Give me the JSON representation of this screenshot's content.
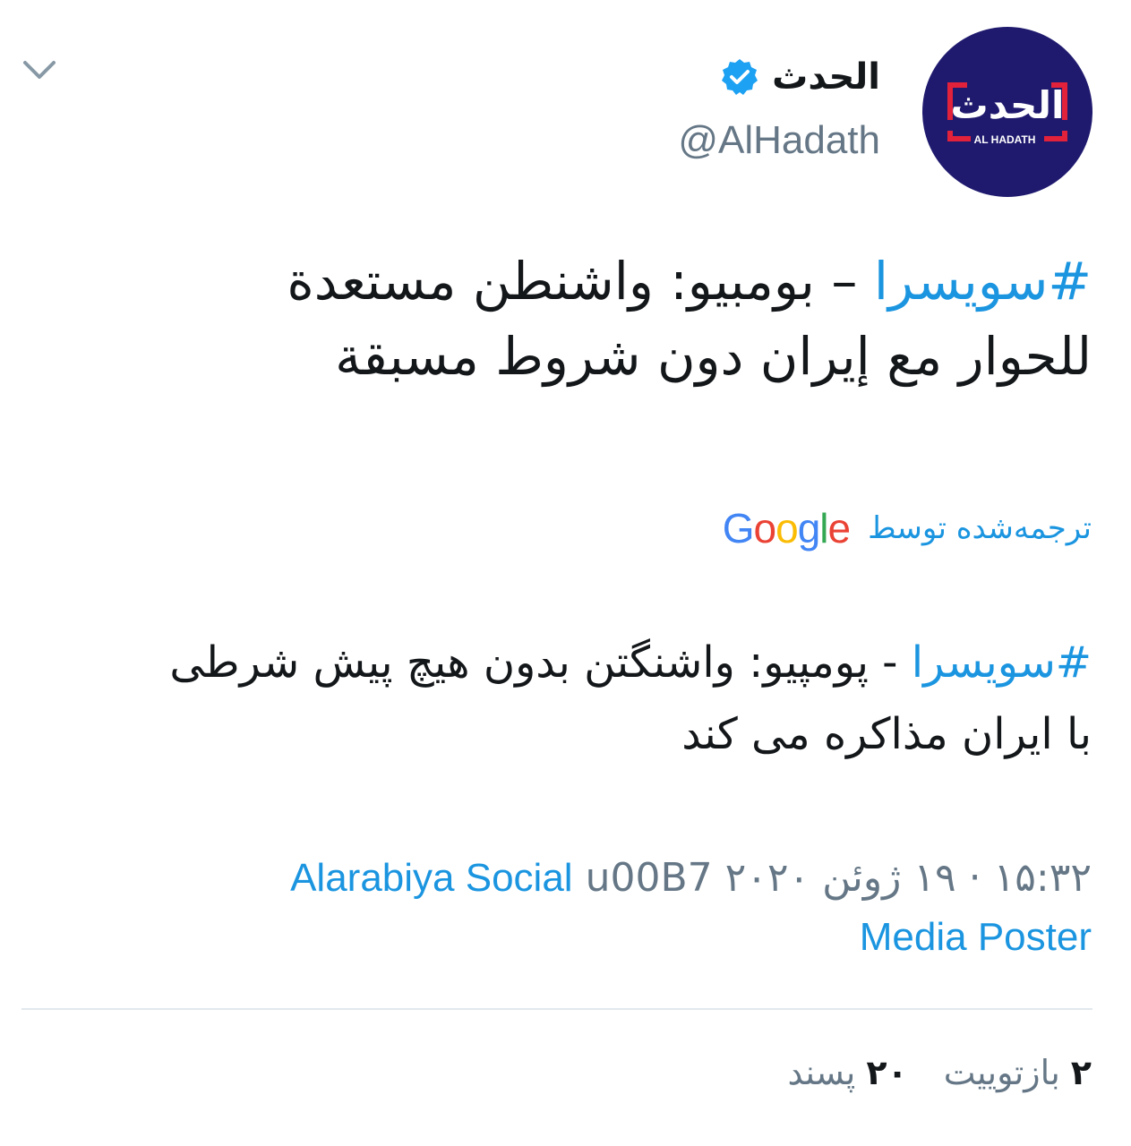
{
  "header": {
    "display_name": "الحدث",
    "handle": "@AlHadath",
    "avatar_text": "الحدث",
    "avatar_subtext": "AL HADATH",
    "verified_icon": "verified-badge-icon",
    "chevron_icon": "chevron-down-icon"
  },
  "tweet": {
    "original": {
      "hashtag": "#سويسرا",
      "line1_rest": " – بومبيو: واشنطن مستعدة",
      "line2": "للحوار مع إيران دون شروط مسبقة"
    },
    "translated_by_label": "ترجمه‌شده توسط",
    "translated_by_brand": [
      "G",
      "o",
      "o",
      "g",
      "l",
      "e"
    ],
    "translation": {
      "hashtag": "#سويسرا",
      "line1_rest": " - پومپیو: واشنگتن بدون هیچ پیش شرطی",
      "line2": "با ایران مذاکره می کند"
    }
  },
  "meta": {
    "time": "۱۵:۳۲",
    "date": "۱۹ ژوئن ۲۰۲۰",
    "separator_text": "u00B7",
    "source_line1": "Alarabiya Social",
    "source_line2": "Media Poster"
  },
  "stats": {
    "retweets_count": "۲",
    "retweets_label": "بازتوییت",
    "likes_count": "۲۰",
    "likes_label": "پسند"
  },
  "colors": {
    "link": "#1b95e0",
    "muted": "#657786",
    "text": "#14171a",
    "avatar_bg": "#1f1a6e",
    "avatar_accent": "#e2213a",
    "google": [
      "#4285F4",
      "#EA4335",
      "#FBBC05",
      "#4285F4",
      "#34A853",
      "#EA4335"
    ]
  }
}
